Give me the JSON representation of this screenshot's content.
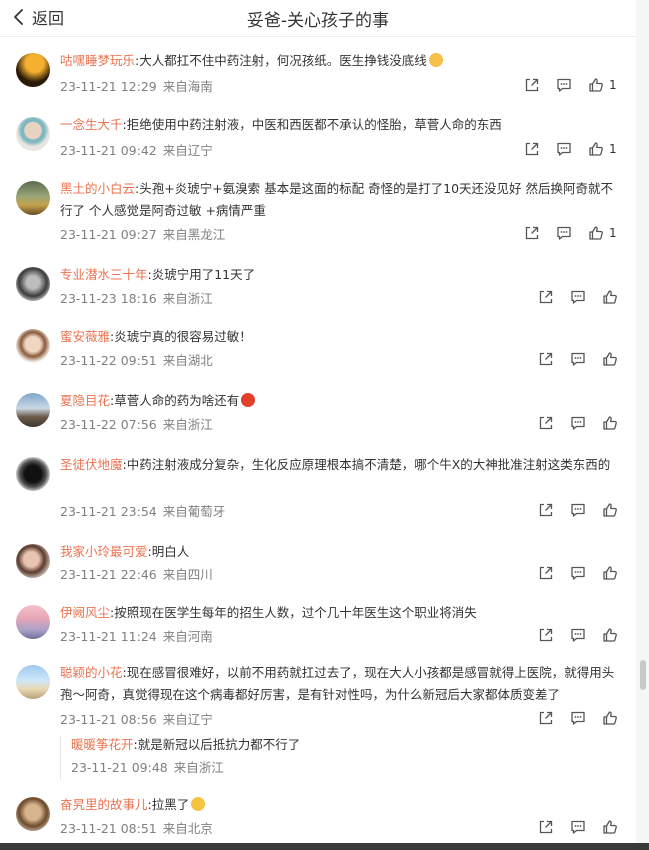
{
  "header": {
    "back_label": "返回",
    "title": "妥爸-关心孩子的事"
  },
  "comments": [
    {
      "user": "咕嘿睡梦玩乐",
      "text": ":大人都扛不住中药注射，何况孩纸。医生挣钱没底线",
      "emoji": "cat-face",
      "time": "23-11-21 12:29",
      "location": "来自海南",
      "likes": "1"
    },
    {
      "user": "一念生大千",
      "text": ":拒绝使用中药注射液，中医和西医都不承认的怪胎，草菅人命的东西",
      "time": "23-11-21 09:42",
      "location": "来自辽宁",
      "likes": "1"
    },
    {
      "user": "黑土的小白云",
      "text": ":头孢+炎琥宁+氨溴索 基本是这面的标配 奇怪的是打了10天还没见好 然后换阿奇就不行了 个人感觉是阿奇过敏 +病情严重",
      "time": "23-11-21 09:27",
      "location": "来自黑龙江",
      "likes": "1"
    },
    {
      "user": "专业潜水三十年",
      "text": ":炎琥宁用了11天了",
      "time": "23-11-23 18:16",
      "location": "来自浙江",
      "likes": ""
    },
    {
      "user": "蜜安薇雅",
      "text": ":炎琥宁真的很容易过敏！",
      "time": "23-11-22 09:51",
      "location": "来自湖北",
      "likes": ""
    },
    {
      "user": "夏隐目花",
      "text": ":草菅人命的药为啥还有",
      "emoji": "angry-face",
      "time": "23-11-22 07:56",
      "location": "来自浙江",
      "likes": ""
    },
    {
      "user": "圣徒伏地魔",
      "text": ":中药注射液成分复杂，生化反应原理根本搞不清楚，哪个牛X的大神批准注射这类东西的",
      "time": "23-11-21 23:54",
      "location": "来自葡萄牙",
      "likes": ""
    },
    {
      "user": "我家小玲最可爱",
      "text": ":明白人",
      "time": "23-11-21 22:46",
      "location": "来自四川",
      "likes": ""
    },
    {
      "user": "伊阙风尘",
      "text": ":按照现在医学生每年的招生人数，过个几十年医生这个职业将消失",
      "time": "23-11-21 11:24",
      "location": "来自河南",
      "likes": ""
    },
    {
      "user": "聪颖的小花",
      "text": ":现在感冒很难好，以前不用药就扛过去了，现在大人小孩都是感冒就得上医院，就得用头孢～阿奇，真觉得现在这个病毒都好厉害，是有针对性吗，为什么新冠后大家都体质变差了",
      "time": "23-11-21 08:56",
      "location": "来自辽宁",
      "likes": "",
      "reply": {
        "user": "暖暖筝花开",
        "text": ":就是新冠以后抵抗力都不行了",
        "time": "23-11-21 09:48",
        "location": "来自浙江"
      }
    },
    {
      "user": "奋旯里的故事儿",
      "text": ":拉黑了",
      "emoji": "grin-face",
      "time": "23-11-21 08:51",
      "location": "来自北京",
      "likes": ""
    }
  ],
  "icons": {
    "back": "chevron-left-icon",
    "share": "share-icon",
    "comment": "comment-icon",
    "like": "thumbs-up-icon"
  },
  "colors": {
    "username": "#eb7350",
    "meta": "#808080",
    "text": "#333333"
  }
}
